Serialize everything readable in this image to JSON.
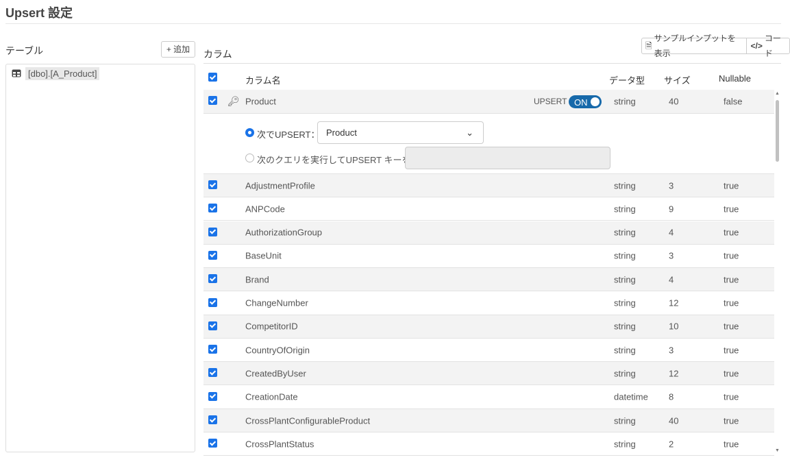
{
  "title": "Upsert 設定",
  "tables": {
    "label": "テーブル",
    "add_button": "+ 追加",
    "items": [
      "[dbo].[A_Product]"
    ]
  },
  "columns": {
    "label": "カラム",
    "sample_button": "サンプルインプットを表示",
    "code_button": "コード",
    "headers": {
      "name": "カラム名",
      "type": "データ型",
      "size": "サイズ",
      "nullable": "Nullable"
    },
    "key_row": {
      "name": "Product",
      "upsert_label": "UPSERT",
      "toggle": "ON",
      "type": "string",
      "size": "40",
      "nullable": "false",
      "option1_label": "次でUPSERT：",
      "option1_value": "Product",
      "option2_label": "次のクエリを実行してUPSERT キーを選択",
      "query_value": ""
    },
    "rows": [
      {
        "name": "AdjustmentProfile",
        "type": "string",
        "size": "3",
        "nullable": "true"
      },
      {
        "name": "ANPCode",
        "type": "string",
        "size": "9",
        "nullable": "true"
      },
      {
        "name": "AuthorizationGroup",
        "type": "string",
        "size": "4",
        "nullable": "true"
      },
      {
        "name": "BaseUnit",
        "type": "string",
        "size": "3",
        "nullable": "true"
      },
      {
        "name": "Brand",
        "type": "string",
        "size": "4",
        "nullable": "true"
      },
      {
        "name": "ChangeNumber",
        "type": "string",
        "size": "12",
        "nullable": "true"
      },
      {
        "name": "CompetitorID",
        "type": "string",
        "size": "10",
        "nullable": "true"
      },
      {
        "name": "CountryOfOrigin",
        "type": "string",
        "size": "3",
        "nullable": "true"
      },
      {
        "name": "CreatedByUser",
        "type": "string",
        "size": "12",
        "nullable": "true"
      },
      {
        "name": "CreationDate",
        "type": "datetime",
        "size": "8",
        "nullable": "true"
      },
      {
        "name": "CrossPlantConfigurableProduct",
        "type": "string",
        "size": "40",
        "nullable": "true"
      },
      {
        "name": "CrossPlantStatus",
        "type": "string",
        "size": "2",
        "nullable": "true"
      }
    ]
  },
  "colors": {
    "accent": "#1a73e8",
    "toggle": "#1769aa"
  }
}
